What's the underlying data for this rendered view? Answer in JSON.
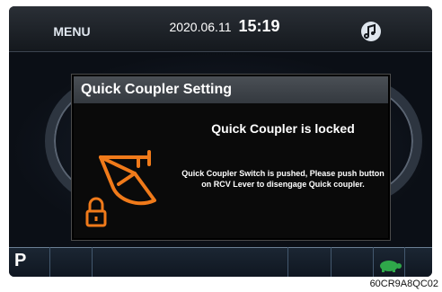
{
  "header": {
    "menu_label": "MENU",
    "date": "2020.06.11",
    "time": "15:19"
  },
  "dialog": {
    "title": "Quick Coupler Setting",
    "heading": "Quick Coupler is locked",
    "message": "Quick Coupler Switch is pushed, Please push button on RCV Lever to disengage Quick coupler."
  },
  "footer": {
    "gear": "P"
  },
  "caption": "60CR9A8QC02",
  "icons": [
    "music-icon",
    "quick-coupler-icon",
    "padlock-icon",
    "turtle-icon"
  ],
  "colors": {
    "accent": "#f07a1a",
    "turtle": "#2fa84a"
  }
}
